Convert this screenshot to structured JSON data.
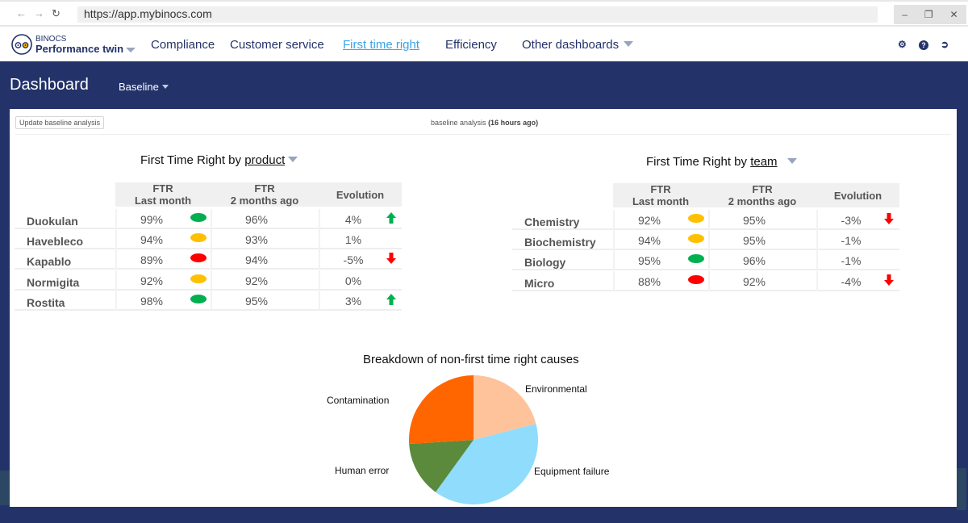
{
  "browser": {
    "back_icon": "arrow-left-icon",
    "forward_icon": "arrow-right-icon",
    "reload_icon": "reload-icon",
    "url": "https://app.mybinocs.com",
    "window_controls": [
      "minimize-icon",
      "restore-icon",
      "close-icon"
    ]
  },
  "header": {
    "brand_small": "BINOCS",
    "brand_big": "Performance twin",
    "nav": [
      {
        "label": "Compliance",
        "active": false
      },
      {
        "label": "Customer service",
        "active": false
      },
      {
        "label": "First time right",
        "active": true
      },
      {
        "label": "Efficiency",
        "active": false
      },
      {
        "label": "Other dashboards",
        "active": false,
        "dropdown": true
      }
    ],
    "icons": [
      "gear-icon",
      "help-icon",
      "logout-icon"
    ]
  },
  "page": {
    "title": "Dashboard",
    "scenario_dropdown": "Baseline"
  },
  "card": {
    "update_button": "Update baseline analysis",
    "status_prefix": "baseline analysis",
    "status_time": "(16 hours ago)"
  },
  "colors": {
    "navy": "#233269",
    "green": "#00b050",
    "amber": "#ffc000",
    "red": "#ff0000",
    "link": "#3ba3e6"
  },
  "product_table": {
    "title_prefix": "First Time Right by",
    "title_key": "product",
    "headers": {
      "last_month_l1": "FTR",
      "last_month_l2": "Last month",
      "two_months_l1": "FTR",
      "two_months_l2": "2 months ago",
      "evolution": "Evolution"
    },
    "rows": [
      {
        "name": "Duokulan",
        "last_month": "99%",
        "status": "green",
        "two_months": "96%",
        "evolution": "4%",
        "trend": "up"
      },
      {
        "name": "Havebleco",
        "last_month": "94%",
        "status": "amber",
        "two_months": "93%",
        "evolution": "1%",
        "trend": "none"
      },
      {
        "name": "Kapablo",
        "last_month": "89%",
        "status": "red",
        "two_months": "94%",
        "evolution": "-5%",
        "trend": "down"
      },
      {
        "name": "Normigita",
        "last_month": "92%",
        "status": "amber",
        "two_months": "92%",
        "evolution": "0%",
        "trend": "none"
      },
      {
        "name": "Rostita",
        "last_month": "98%",
        "status": "green",
        "two_months": "95%",
        "evolution": "3%",
        "trend": "up"
      }
    ]
  },
  "team_table": {
    "title_prefix": "First Time Right by",
    "title_key": "team",
    "headers": {
      "last_month_l1": "FTR",
      "last_month_l2": "Last month",
      "two_months_l1": "FTR",
      "two_months_l2": "2 months ago",
      "evolution": "Evolution"
    },
    "rows": [
      {
        "name": "Chemistry",
        "last_month": "92%",
        "status": "amber",
        "two_months": "95%",
        "evolution": "-3%",
        "trend": "down"
      },
      {
        "name": "Biochemistry",
        "last_month": "94%",
        "status": "amber",
        "two_months": "95%",
        "evolution": "-1%",
        "trend": "none"
      },
      {
        "name": "Biology",
        "last_month": "95%",
        "status": "green",
        "two_months": "96%",
        "evolution": "-1%",
        "trend": "none"
      },
      {
        "name": "Micro",
        "last_month": "88%",
        "status": "red",
        "two_months": "92%",
        "evolution": "-4%",
        "trend": "down"
      }
    ]
  },
  "chart_data": {
    "type": "pie",
    "title": "Breakdown of non-first time right causes",
    "categories": [
      "Environmental",
      "Equipment failure",
      "Human error",
      "Contamination"
    ],
    "values": [
      21,
      39,
      14,
      26
    ],
    "colors": [
      "#ffc39b",
      "#8fdcfd",
      "#5b8a3c",
      "#ff6600"
    ],
    "start": "top",
    "direction": "clockwise",
    "legend": "none (labels beside slices)"
  }
}
